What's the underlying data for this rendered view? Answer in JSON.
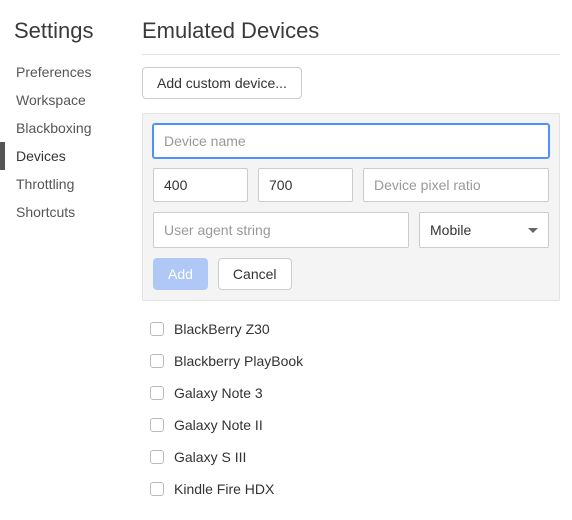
{
  "sidebar": {
    "title": "Settings",
    "items": [
      {
        "label": "Preferences",
        "active": false
      },
      {
        "label": "Workspace",
        "active": false
      },
      {
        "label": "Blackboxing",
        "active": false
      },
      {
        "label": "Devices",
        "active": true
      },
      {
        "label": "Throttling",
        "active": false
      },
      {
        "label": "Shortcuts",
        "active": false
      }
    ]
  },
  "main": {
    "title": "Emulated Devices",
    "add_custom_label": "Add custom device...",
    "form": {
      "device_name_placeholder": "Device name",
      "device_name_value": "",
      "width_value": "400",
      "height_value": "700",
      "dpr_placeholder": "Device pixel ratio",
      "dpr_value": "",
      "ua_placeholder": "User agent string",
      "ua_value": "",
      "type_selected": "Mobile",
      "add_label": "Add",
      "cancel_label": "Cancel"
    },
    "devices": [
      {
        "label": "BlackBerry Z30",
        "checked": false
      },
      {
        "label": "Blackberry PlayBook",
        "checked": false
      },
      {
        "label": "Galaxy Note 3",
        "checked": false
      },
      {
        "label": "Galaxy Note II",
        "checked": false
      },
      {
        "label": "Galaxy S III",
        "checked": false
      },
      {
        "label": "Kindle Fire HDX",
        "checked": false
      }
    ]
  }
}
